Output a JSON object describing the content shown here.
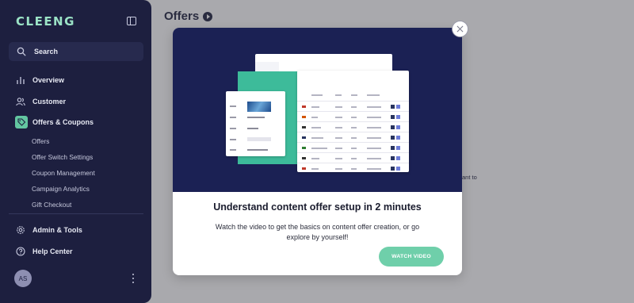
{
  "app": {
    "logo": "CLEENG"
  },
  "sidebar": {
    "search_label": "Search",
    "items": [
      {
        "label": "Overview",
        "icon": "bar-chart-icon"
      },
      {
        "label": "Customer",
        "icon": "users-icon"
      },
      {
        "label": "Offers & Coupons",
        "icon": "tag-icon",
        "active": true
      },
      {
        "label": "Admin & Tools",
        "icon": "gear-icon"
      },
      {
        "label": "Help Center",
        "icon": "help-icon"
      }
    ],
    "sub_items": [
      {
        "label": "Offers"
      },
      {
        "label": "Offer Switch Settings"
      },
      {
        "label": "Coupon Management"
      },
      {
        "label": "Campaign Analytics"
      },
      {
        "label": "Gift Checkout"
      }
    ],
    "user_initials": "AS"
  },
  "page": {
    "title": "Offers",
    "background_fragment": "ant to"
  },
  "modal": {
    "title": "Understand content offer setup in 2 minutes",
    "description": "Watch the video to get the basics on content offer creation, or go explore by yourself!",
    "button_label": "WATCH VIDEO"
  },
  "colors": {
    "sidebar_bg": "#1d1f3f",
    "accent": "#63c6a1",
    "modal_hero": "#1b2154",
    "button": "#6fcfaa"
  }
}
